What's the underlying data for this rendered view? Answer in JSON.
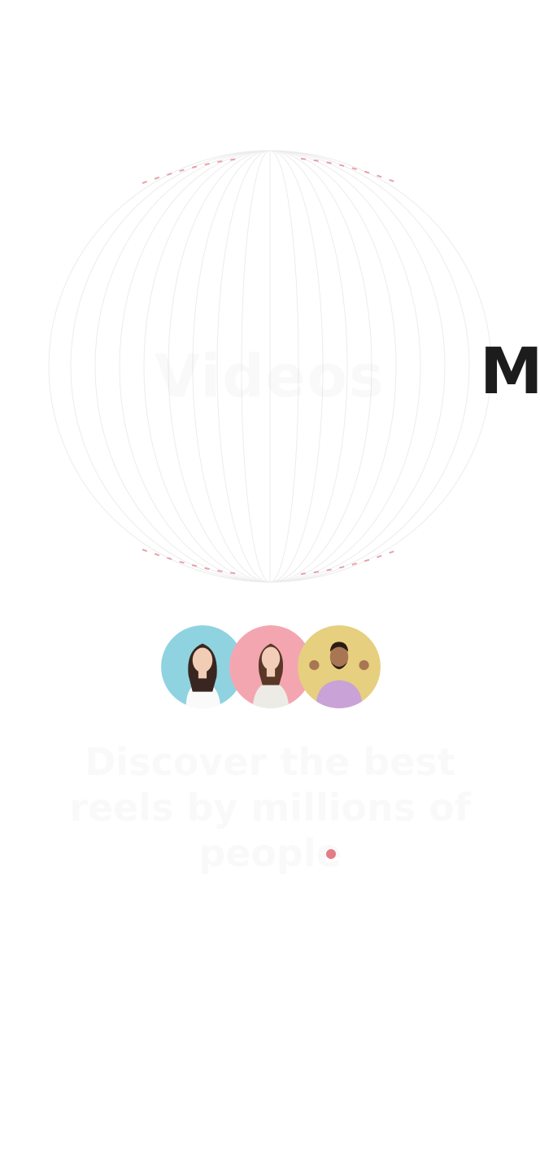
{
  "splash": {
    "headline": "Videos",
    "brand_partial": "M",
    "tagline": "Discover the best reels by millions of people"
  },
  "avatars": [
    {
      "name": "woman-avatar",
      "bg": "#8fd3e1"
    },
    {
      "name": "woman-avatar",
      "bg": "#f4a6b0"
    },
    {
      "name": "man-avatar",
      "bg": "#e6cf7e"
    }
  ],
  "colors": {
    "accent": "#d9515e",
    "brand_text": "#1c1c1c",
    "background": "#ffffff"
  }
}
